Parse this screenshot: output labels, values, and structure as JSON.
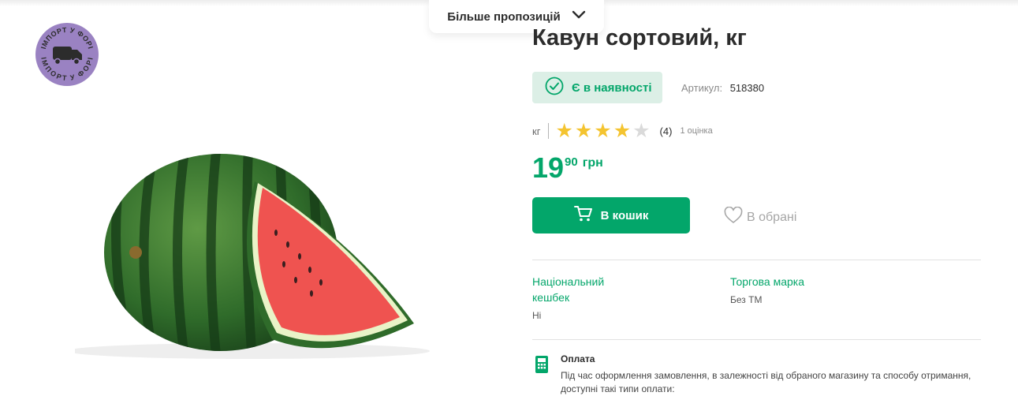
{
  "header": {
    "more_offers_label": "Більше пропозицій"
  },
  "badge": {
    "text_top": "ІМПОРТ У ФОРІ",
    "text_bottom": "ІМПОРТ У ФОРІ",
    "color": "#9a82c2",
    "icon": "truck-icon"
  },
  "product": {
    "title": "Кавун сортовий, кг",
    "stock_label": "Є в наявності",
    "sku_label": "Артикул:",
    "sku_value": "518380",
    "unit": "кг",
    "rating": 4,
    "rating_max": 5,
    "review_count": "(4)",
    "review_text": "1 оцінка",
    "price_int": "19",
    "price_kop": "90",
    "currency": "грн",
    "image_icon": "watermelon-image"
  },
  "actions": {
    "cart_label": "В кошик",
    "favorite_label": "В обрані"
  },
  "attributes": [
    {
      "key": "Національний кешбек",
      "value": "Ні"
    },
    {
      "key": "Торгова марка",
      "value": "Без ТМ"
    }
  ],
  "payment": {
    "title": "Оплата",
    "text": "Під час оформлення замовлення, в залежності від обраного магазину та способу отримання, доступні такі типи оплати:",
    "icon": "payment-terminal-icon"
  },
  "colors": {
    "accent": "#03a66a",
    "stock_bg": "#dcefe6",
    "star": "#f4c430"
  }
}
